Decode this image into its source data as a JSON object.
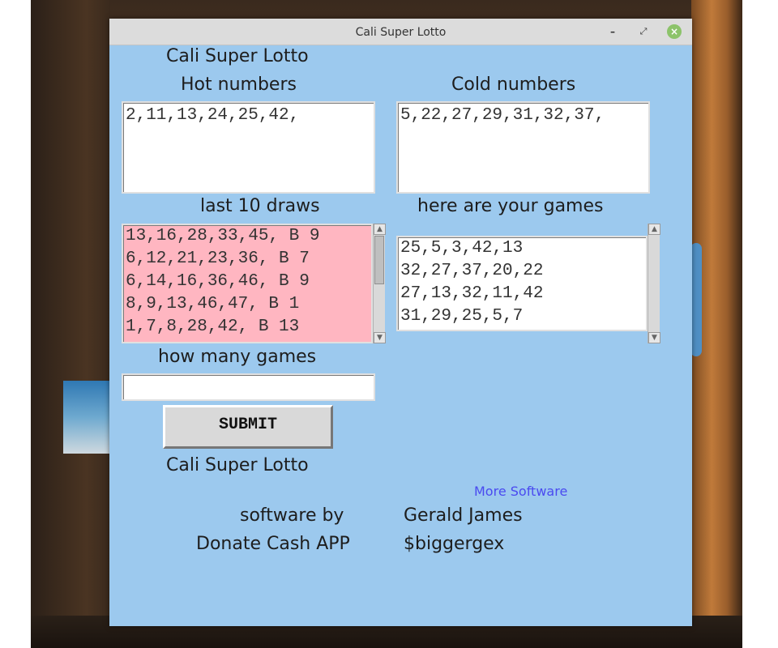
{
  "window": {
    "title": "Cali Super Lotto",
    "minimize_glyph": "–",
    "maximize_glyph": "⤢",
    "close_glyph": "×"
  },
  "header": {
    "app_title": "Cali Super Lotto"
  },
  "hot": {
    "label": "Hot numbers",
    "value": "2,11,13,24,25,42,"
  },
  "cold": {
    "label": "Cold numbers",
    "value": "5,22,27,29,31,32,37,"
  },
  "draws": {
    "label": "last 10 draws",
    "lines": [
      "13,16,28,33,45, B 9",
      "6,12,21,23,36, B 7",
      "6,14,16,36,46, B 9",
      "8,9,13,46,47, B 1",
      "1,7,8,28,42, B 13"
    ]
  },
  "games": {
    "label": "here are your games",
    "lines": [
      "25,5,3,42,13",
      "32,27,37,20,22",
      "27,13,32,11,42",
      "31,29,25,5,7"
    ]
  },
  "how_many": {
    "label": "how many games",
    "value": ""
  },
  "submit": {
    "label": "SUBMIT"
  },
  "footer": {
    "app_title": "Cali Super Lotto",
    "more_software": "More Software",
    "software_by_label": "software by",
    "author": "Gerald James",
    "donate_label": "Donate Cash APP",
    "cash_tag": "$biggergex"
  },
  "colors": {
    "window_bg": "#9cc9ee",
    "draws_bg": "#ffb6c1",
    "link": "#4a4af0"
  }
}
